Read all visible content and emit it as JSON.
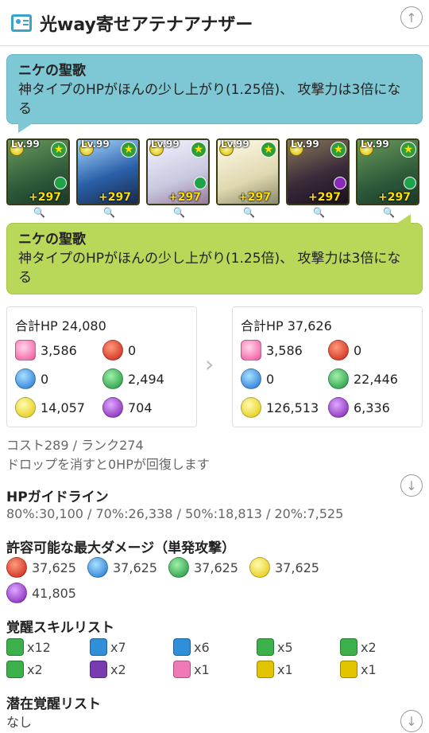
{
  "header": {
    "title": "光way寄せアテナアナザー",
    "icon": "id-card-icon",
    "scroll_up_icon": "arrow-up-icon"
  },
  "leader_top": {
    "title": "ニケの聖歌",
    "text": "神タイプのHPがほんの少し上がり(1.25倍)、 攻撃力は3倍になる"
  },
  "team": [
    {
      "level": "Lv.99",
      "plus": "+297",
      "portrait_color": "#3a7a5a",
      "sub_color": "#1fa34a"
    },
    {
      "level": "Lv.99",
      "plus": "+297",
      "portrait_color": "#2a5fa8",
      "sub_color": "#e7c800"
    },
    {
      "level": "Lv.99",
      "plus": "+297",
      "portrait_color": "#d8d8e8",
      "sub_color": "#1fa34a"
    },
    {
      "level": "Lv.99",
      "plus": "+297",
      "portrait_color": "#e8e4c8",
      "sub_color": "#e7c800"
    },
    {
      "level": "Lv.99",
      "plus": "+297",
      "portrait_color": "#3a2a3a",
      "sub_color": "#8a2ab8"
    },
    {
      "level": "Lv.99",
      "plus": "+297",
      "portrait_color": "#3a7a5a",
      "sub_color": "#1fa34a"
    }
  ],
  "leader_bottom": {
    "title": "ニケの聖歌",
    "text": "神タイプのHPがほんの少し上がり(1.25倍)、 攻撃力は3倍になる"
  },
  "stats_base": {
    "total_hp": "合計HP 24,080",
    "heal": "3,586",
    "fire": "0",
    "water": "0",
    "wood": "2,494",
    "light": "14,057",
    "dark": "704"
  },
  "stats_boost": {
    "total_hp": "合計HP 37,626",
    "heal": "3,586",
    "fire": "0",
    "water": "0",
    "wood": "22,446",
    "light": "126,513",
    "dark": "6,336"
  },
  "cost_rank": "コスト289 / ランク274",
  "drop_heal": "ドロップを消すと0HPが回復します",
  "hp_guide": {
    "heading": "HPガイドライン",
    "text": "80%:30,100 / 70%:26,338 / 50%:18,813 / 20%:7,525"
  },
  "max_damage": {
    "heading": "許容可能な最大ダメージ（単発攻撃）",
    "fire": "37,625",
    "water": "37,625",
    "wood": "37,625",
    "light": "37,625",
    "dark": "41,805"
  },
  "awakenings": {
    "heading": "覚醒スキルリスト",
    "items": [
      {
        "count": "x12",
        "color": "#3cb04a"
      },
      {
        "count": "x7",
        "color": "#2f8fd8"
      },
      {
        "count": "x6",
        "color": "#2f8fd8"
      },
      {
        "count": "x5",
        "color": "#3cb04a"
      },
      {
        "count": "x2",
        "color": "#3cb04a"
      },
      {
        "count": "x2",
        "color": "#3cb04a"
      },
      {
        "count": "x2",
        "color": "#7a3ab0"
      },
      {
        "count": "x1",
        "color": "#f07ab8"
      },
      {
        "count": "x1",
        "color": "#e2c500"
      },
      {
        "count": "x1",
        "color": "#e2c500"
      }
    ]
  },
  "latent": {
    "heading": "潜在覚醒リスト",
    "text": "なし"
  }
}
